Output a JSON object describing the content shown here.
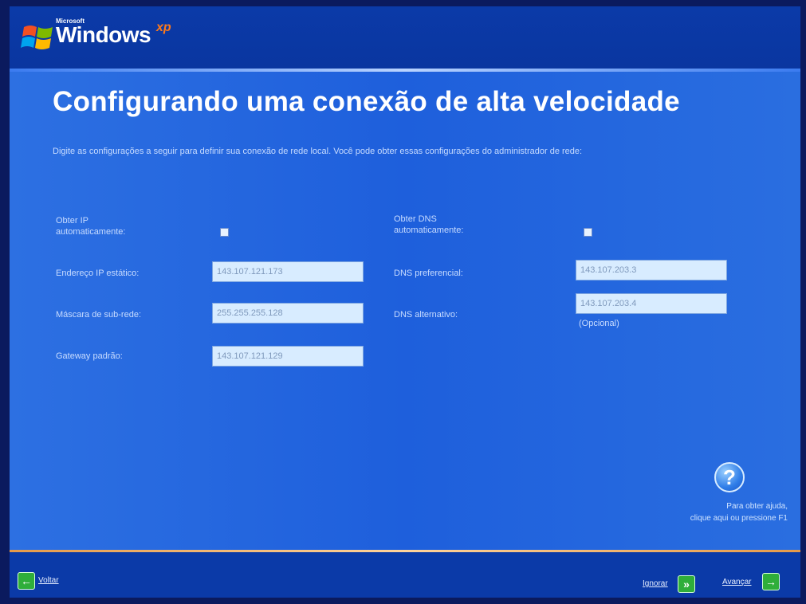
{
  "header": {
    "brand_small": "Microsoft",
    "brand": "Windows",
    "brand_suffix": "xp"
  },
  "page": {
    "title": "Configurando uma conexão de alta velocidade",
    "description": "Digite as configurações a seguir para definir sua conexão de rede local. Você pode obter essas configurações do administrador de rede:"
  },
  "form": {
    "left": {
      "auto_ip_label": "Obter IP automaticamente:",
      "auto_ip_checked": false,
      "static_ip_label": "Endereço IP estático:",
      "static_ip_value": "143.107.121.173",
      "subnet_label": "Máscara de sub-rede:",
      "subnet_value": "255.255.255.128",
      "gateway_label": "Gateway padrão:",
      "gateway_value": "143.107.121.129"
    },
    "right": {
      "auto_dns_label": "Obter DNS automaticamente:",
      "auto_dns_checked": false,
      "preferred_dns_label": "DNS preferencial:",
      "preferred_dns_value": "143.107.203.3",
      "alternate_dns_label": "DNS alternativo:",
      "alternate_dns_value": "143.107.203.4",
      "optional_label": "(Opcional)"
    }
  },
  "help": {
    "icon": "question-icon",
    "text_line1": "Para obter ajuda,",
    "text_line2": "clique aqui ou pressione F1"
  },
  "footer": {
    "back_label": "Voltar",
    "skip_label": "Ignorar",
    "next_label": "Avançar"
  },
  "colors": {
    "content_blue": "#2a6ee0",
    "bar_blue": "#0b3aa8",
    "label_text": "#c8dcff",
    "field_bg": "#d8ecff",
    "nav_green": "#2fae3a",
    "accent_orange": "#ff7a1a"
  }
}
